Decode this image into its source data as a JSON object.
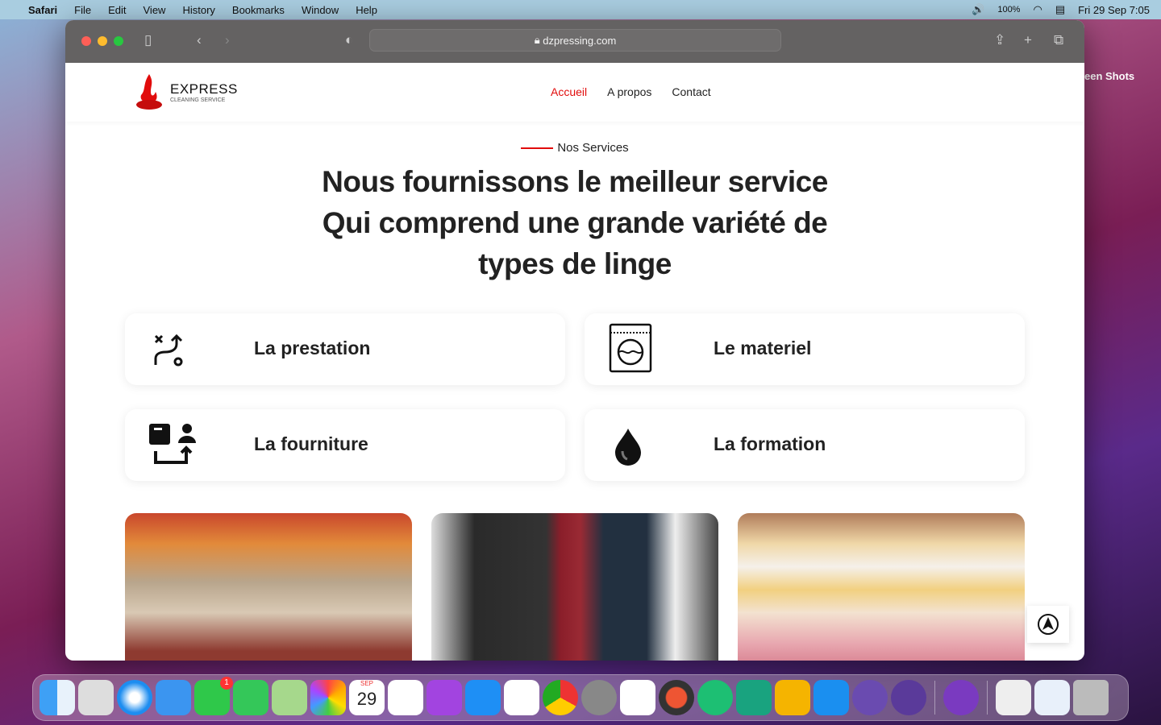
{
  "menubar": {
    "app": "Safari",
    "items": [
      "File",
      "Edit",
      "View",
      "History",
      "Bookmarks",
      "Window",
      "Help"
    ],
    "battery": "100%",
    "datetime": "Fri 29 Sep  7:05"
  },
  "browser": {
    "url": "dzpressing.com"
  },
  "desktop": {
    "label": "een Shots"
  },
  "site": {
    "logo": {
      "title": "EXPRESS",
      "subtitle": "CLEANING SERVICE"
    },
    "nav": [
      "Accueil",
      "A propos",
      "Contact"
    ],
    "section_label": "Nos Services",
    "heading": [
      "Nous fournissons le meilleur service",
      "Qui comprend une grande variété de",
      "types de linge"
    ],
    "services": [
      {
        "title": "La prestation",
        "icon": "route-icon"
      },
      {
        "title": "Le materiel",
        "icon": "washing-machine-icon"
      },
      {
        "title": "La fourniture",
        "icon": "delivery-icon"
      },
      {
        "title": "La formation",
        "icon": "drop-icon"
      }
    ]
  },
  "dock": {
    "calendar_month": "SEP",
    "calendar_day": "29",
    "facetime_badge": "1"
  },
  "colors": {
    "accent": "#e10c0c",
    "toolbar": "#646262"
  }
}
